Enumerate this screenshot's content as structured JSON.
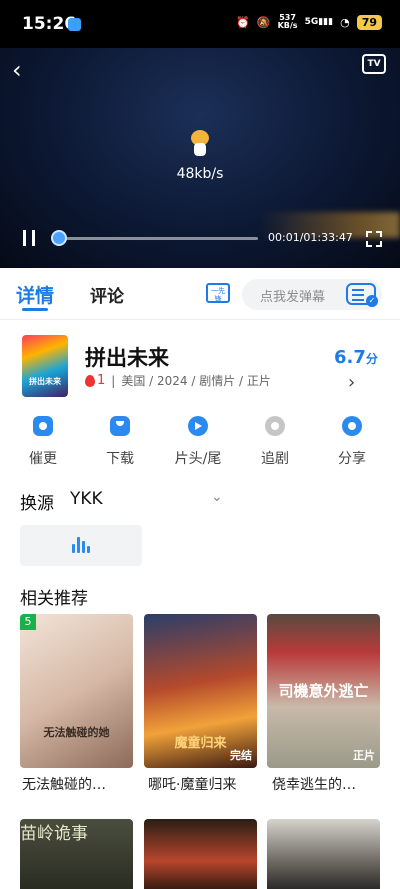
{
  "status_bar": {
    "time": "15:26",
    "net_speed_value": "537",
    "net_speed_unit": "KB/s",
    "signal": "5G",
    "battery": "79"
  },
  "player": {
    "buffering_speed": "48kb/s",
    "current_time": "00:01",
    "total_time": "01:33:47",
    "time_display": "00:01/01:33:47",
    "progress": 0.0,
    "cast_icon_label": "TV"
  },
  "tabs": {
    "detail": "详情",
    "comment": "评论",
    "danmu_placeholder": "点我发弹幕",
    "danmu_toggle_label": "一先锋"
  },
  "movie": {
    "title": "拼出未来",
    "heat": "1",
    "meta": "美国 / 2024 / 剧情片 / 正片",
    "score": "6.7",
    "score_unit": "分"
  },
  "actions": [
    {
      "label": "催更",
      "icon": "home-update-icon",
      "color": "#2a8af0"
    },
    {
      "label": "下载",
      "icon": "download-icon",
      "color": "#2a8af0"
    },
    {
      "label": "片头/尾",
      "icon": "play-skip-icon",
      "color": "#2a8af0"
    },
    {
      "label": "追剧",
      "icon": "heart-icon",
      "color": "#c6c6c6"
    },
    {
      "label": "分享",
      "icon": "share-icon",
      "color": "#2a8af0"
    }
  ],
  "source": {
    "label": "换源",
    "value": "YKK"
  },
  "recommendations": {
    "title": "相关推荐",
    "items": [
      {
        "caption": "无法触碰的…",
        "poster_text": "无法触碰的她",
        "tag": "",
        "rank": "5"
      },
      {
        "caption": "哪吒·魔童归来",
        "poster_text": "魔童归来",
        "tag": "完结",
        "rank": ""
      },
      {
        "caption": "侥幸逃生的…",
        "poster_text": "司機意外逃亡",
        "tag": "正片",
        "rank": ""
      }
    ],
    "second_row_text": "苗岭诡事"
  },
  "colors": {
    "accent": "#1e7be6",
    "video_bg": "#0c1833",
    "heat_red": "#e33333",
    "rank_green": "#1bb04a"
  }
}
